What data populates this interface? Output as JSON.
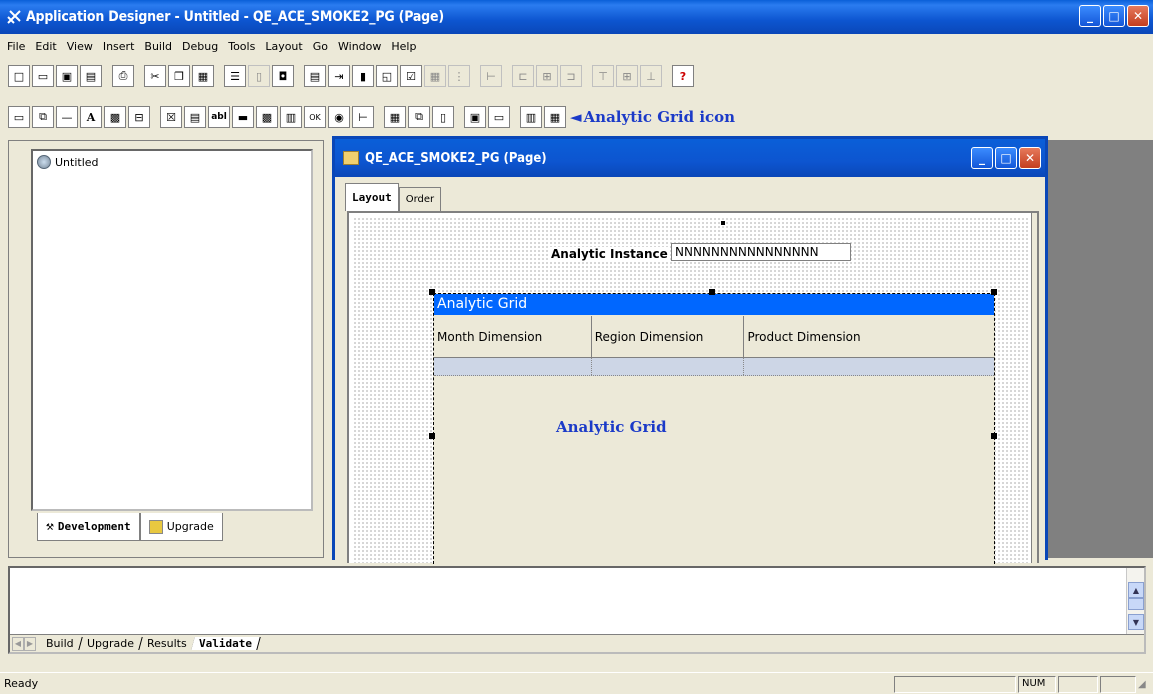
{
  "window": {
    "title": "Application Designer - Untitled - QE_ACE_SMOKE2_PG (Page)"
  },
  "menu": [
    "File",
    "Edit",
    "View",
    "Insert",
    "Build",
    "Debug",
    "Tools",
    "Layout",
    "Go",
    "Window",
    "Help"
  ],
  "annotation": {
    "arrow": "◄",
    "label": "Analytic Grid icon"
  },
  "project": {
    "tree_item": "Untitled",
    "tabs": [
      "Development",
      "Upgrade"
    ]
  },
  "child": {
    "title": "QE_ACE_SMOKE2_PG (Page)",
    "tabs": [
      "Layout",
      "Order"
    ],
    "instance_label": "Analytic Instance",
    "instance_value": "NNNNNNNNNNNNNNNN",
    "grid": {
      "title": "Analytic Grid",
      "columns": [
        "Month Dimension",
        "Region Dimension",
        "Product Dimension"
      ],
      "caption": "Analytic Grid"
    }
  },
  "output": {
    "tabs": [
      "Build",
      "Upgrade",
      "Results",
      "Validate"
    ],
    "active_tab": "Validate"
  },
  "status": {
    "message": "Ready",
    "num": "NUM"
  },
  "colors": {
    "titlebar": "#0a47b8",
    "grid_header": "#0067ff",
    "annotation": "#1b3ac8"
  }
}
